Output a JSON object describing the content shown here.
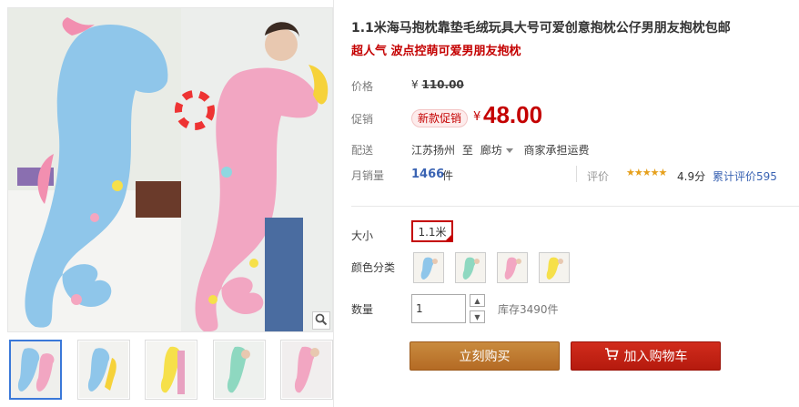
{
  "product": {
    "title": "1.1米海马抱枕靠垫毛绒玩具大号可爱创意抱枕公仔男朋友抱枕包邮",
    "subtitle": "超人气 波点控萌可爱男朋友抱枕"
  },
  "price": {
    "label": "价格",
    "currency": "¥",
    "original": "110.00"
  },
  "promo": {
    "label": "促销",
    "tag": "新款促销",
    "currency": "¥",
    "price": "48.00"
  },
  "shipping": {
    "label": "配送",
    "from": "江苏扬州",
    "to_word": "至",
    "destination": "廊坊",
    "fee": "商家承担运费"
  },
  "sales": {
    "label": "月销量",
    "count": "1466",
    "unit": "件"
  },
  "rating": {
    "label": "评价",
    "stars": "★★★★★",
    "score": "4.9分",
    "review_text": "累计评价595"
  },
  "options": {
    "size_label": "大小",
    "size_value": "1.1米",
    "color_label": "颜色分类"
  },
  "quantity": {
    "label": "数量",
    "value": "1",
    "stock": "库存3490件"
  },
  "buttons": {
    "buy": "立刻购买",
    "cart": "加入购物车"
  },
  "colors": {
    "accent": "#c40000",
    "buy_button": "#b46a24",
    "cart_button": "#c21f12",
    "link": "#3a63b3"
  },
  "icons": {
    "zoom": "magnifier-icon",
    "cart": "shopping-cart-icon"
  }
}
